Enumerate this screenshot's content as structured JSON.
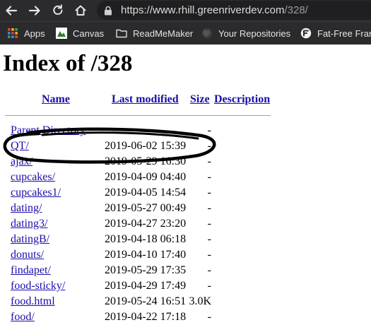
{
  "browser": {
    "url_host": "https://www.rhill.greenriverdev.com",
    "url_path": "/328/",
    "bookmarks": [
      {
        "label": "Apps",
        "icon": "apps-grid-icon"
      },
      {
        "label": "Canvas",
        "icon": "canvas-logo-icon"
      },
      {
        "label": "ReadMeMaker",
        "icon": "folder-icon"
      },
      {
        "label": "Your Repositories",
        "icon": "github-icon"
      },
      {
        "label": "Fat-Free Fram",
        "icon": "fatfree-logo-icon"
      }
    ]
  },
  "page": {
    "title": "Index of /328",
    "columns": {
      "name": "Name",
      "last_modified": "Last modified",
      "size": "Size",
      "description": "Description"
    },
    "rows": [
      {
        "name": "Parent Directory",
        "date": "",
        "size": "-"
      },
      {
        "name": "QT/",
        "date": "2019-06-02 15:39",
        "size": "-"
      },
      {
        "name": "ajax/",
        "date": "2019-05-29 16:30",
        "size": "-"
      },
      {
        "name": "cupcakes/",
        "date": "2019-04-09 04:40",
        "size": "-"
      },
      {
        "name": "cupcakes1/",
        "date": "2019-04-05 14:54",
        "size": "-"
      },
      {
        "name": "dating/",
        "date": "2019-05-27 00:49",
        "size": "-"
      },
      {
        "name": "dating3/",
        "date": "2019-04-27 23:20",
        "size": "-"
      },
      {
        "name": "datingB/",
        "date": "2019-04-18 06:18",
        "size": "-"
      },
      {
        "name": "donuts/",
        "date": "2019-04-10 17:40",
        "size": "-"
      },
      {
        "name": "findapet/",
        "date": "2019-05-29 17:35",
        "size": "-"
      },
      {
        "name": "food-sticky/",
        "date": "2019-04-29 17:49",
        "size": "-"
      },
      {
        "name": "food.html",
        "date": "2019-05-24 16:51",
        "size": "3.0K"
      },
      {
        "name": "food/",
        "date": "2019-04-22 17:18",
        "size": "-"
      }
    ]
  }
}
